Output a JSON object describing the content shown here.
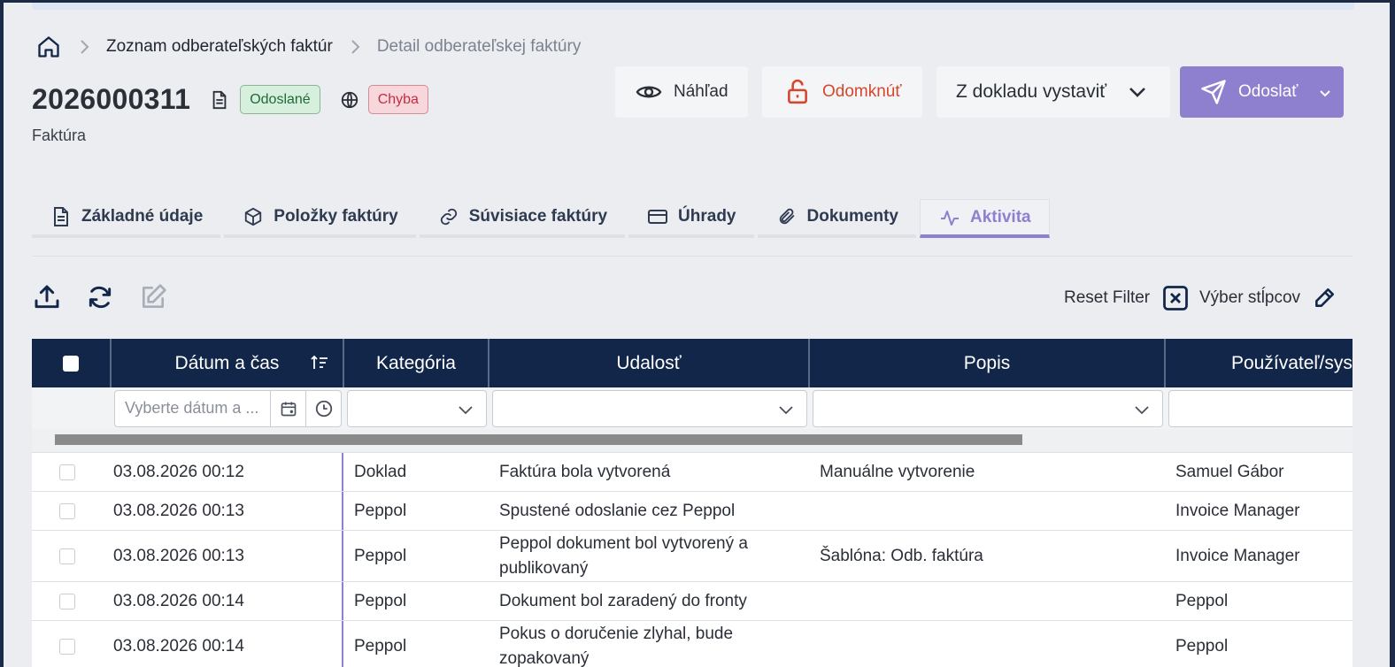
{
  "breadcrumb": {
    "items": [
      "Zoznam odberateľských faktúr",
      "Detail odberateľskej faktúry"
    ]
  },
  "header": {
    "doc_number": "2026000311",
    "status_sent": "Odoslané",
    "status_error": "Chyba",
    "doc_type": "Faktúra"
  },
  "actions": {
    "preview": "Náhľad",
    "unlock": "Odomknúť",
    "issue_from": "Z dokladu vystaviť",
    "send": "Odoslať"
  },
  "tabs": [
    {
      "label": "Základné údaje",
      "icon": "document-icon"
    },
    {
      "label": "Položky faktúry",
      "icon": "box-icon"
    },
    {
      "label": "Súvisiace faktúry",
      "icon": "link-icon"
    },
    {
      "label": "Úhrady",
      "icon": "card-icon"
    },
    {
      "label": "Dokumenty",
      "icon": "paperclip-icon"
    },
    {
      "label": "Aktivita",
      "icon": "activity-icon",
      "active": true
    }
  ],
  "toolbar": {
    "reset_filter": "Reset Filter",
    "column_select": "Výber stĺpcov"
  },
  "grid": {
    "columns": [
      "Dátum a čas",
      "Kategória",
      "Udalosť",
      "Popis",
      "Používateľ/syst"
    ],
    "date_placeholder": "Vyberte dátum a ...",
    "rows": [
      {
        "date": "03.08.2026 00:12",
        "category": "Doklad",
        "event": "Faktúra bola vytvorená",
        "description": "Manuálne vytvorenie",
        "user": "Samuel Gábor"
      },
      {
        "date": "03.08.2026 00:13",
        "category": "Peppol",
        "event": "Spustené odoslanie cez Peppol",
        "description": "",
        "user": "Invoice Manager"
      },
      {
        "date": "03.08.2026 00:13",
        "category": "Peppol",
        "event": "Peppol dokument bol vytvorený a publikovaný",
        "description": "Šablóna: Odb. faktúra",
        "user": "Invoice Manager"
      },
      {
        "date": "03.08.2026 00:14",
        "category": "Peppol",
        "event": "Dokument bol zaradený do fronty",
        "description": "",
        "user": "Peppol"
      },
      {
        "date": "03.08.2026 00:14",
        "category": "Peppol",
        "event": "Pokus o doručenie zlyhal, bude zopakovaný",
        "description": "",
        "user": "Peppol"
      }
    ]
  },
  "colors": {
    "accent": "#8f7fcf",
    "header_bg": "#12264a",
    "unlock": "#d8452d",
    "badge_ok": "#d7efdd",
    "badge_err": "#f8d7dc"
  }
}
